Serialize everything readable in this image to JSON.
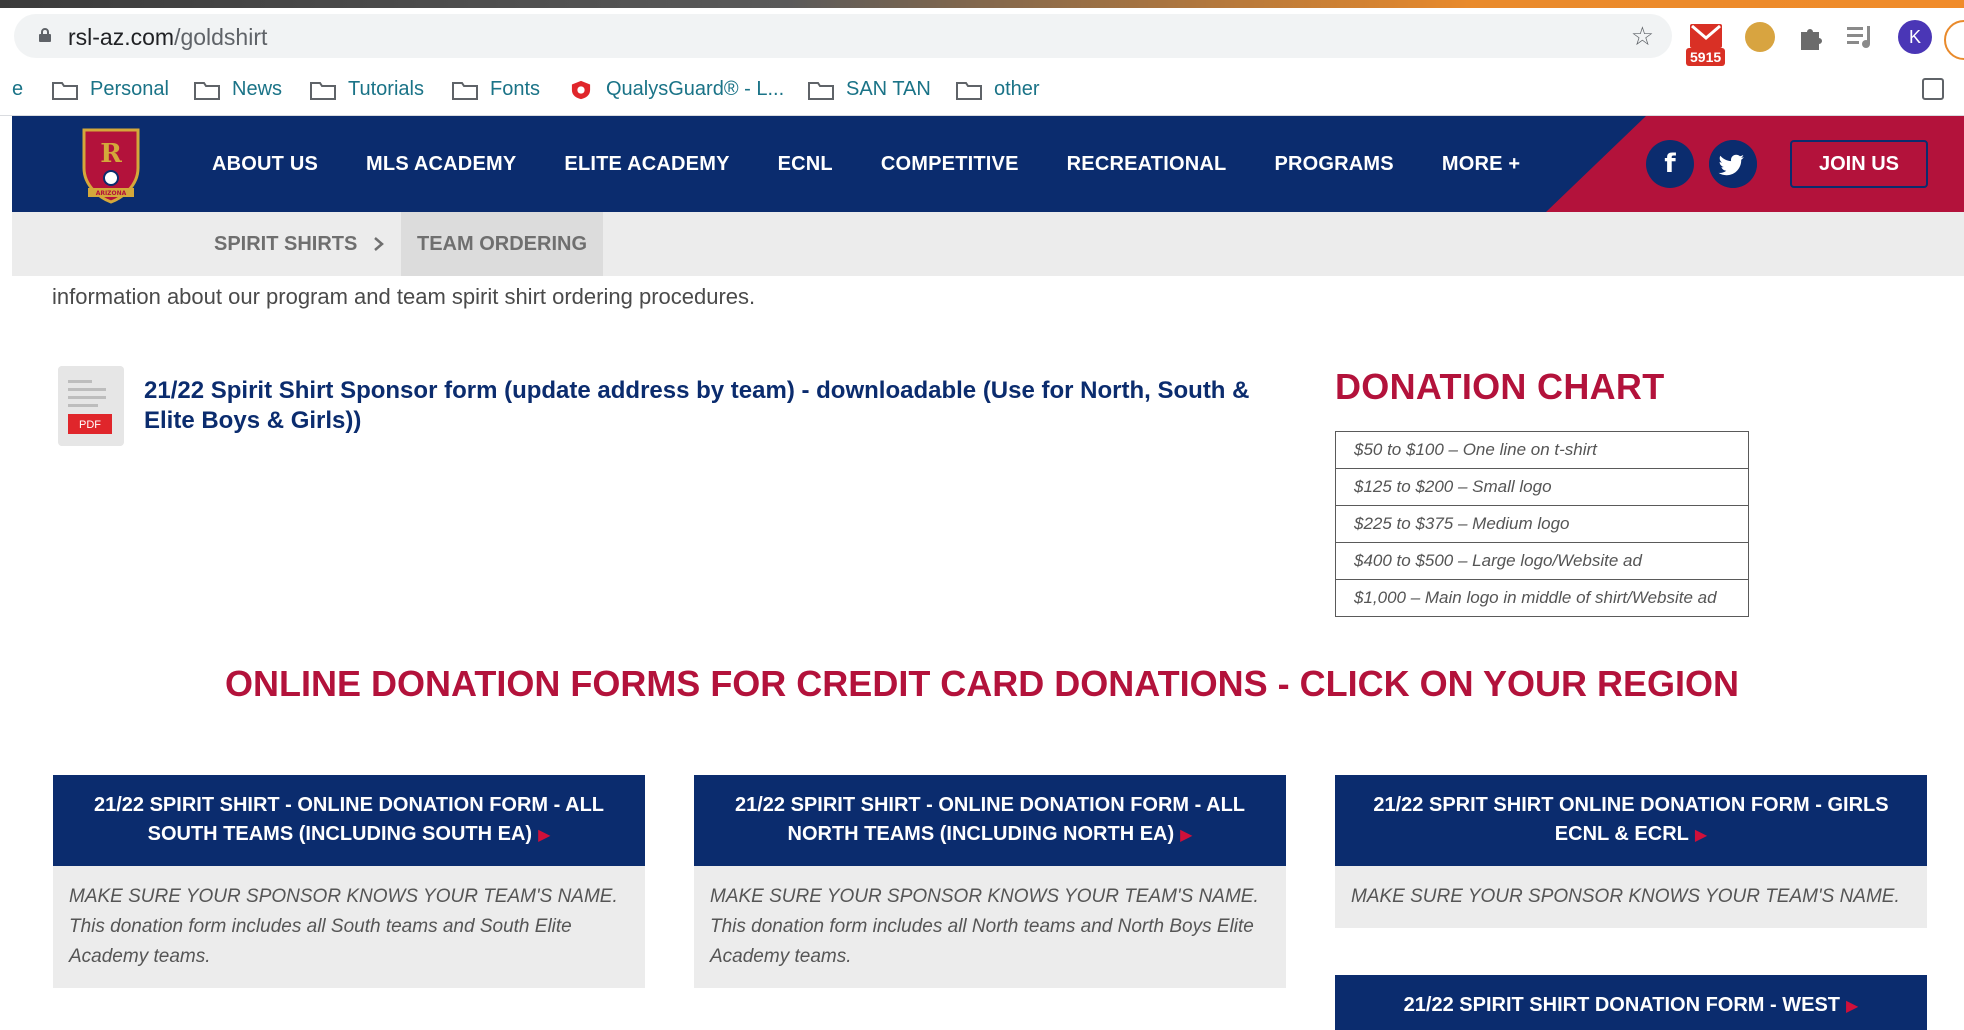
{
  "browser": {
    "url_host": "rsl-az.com",
    "url_path": "/goldshirt",
    "gmail_badge": "5915",
    "avatar_letter": "K",
    "bookmarks": [
      {
        "label": "e"
      },
      {
        "label": "Personal"
      },
      {
        "label": "News"
      },
      {
        "label": "Tutorials"
      },
      {
        "label": "Fonts"
      },
      {
        "label": "QualysGuard® - L..."
      },
      {
        "label": "SAN TAN"
      },
      {
        "label": "other"
      }
    ]
  },
  "site": {
    "nav": [
      "ABOUT US",
      "MLS ACADEMY",
      "ELITE ACADEMY",
      "ECNL",
      "COMPETITIVE",
      "RECREATIONAL",
      "PROGRAMS",
      "MORE +"
    ],
    "social": {
      "facebook": "f"
    },
    "join_label": "JOIN US",
    "breadcrumb": [
      "SPIRIT SHIRTS",
      "TEAM ORDERING"
    ],
    "crest_text": "ARIZONA",
    "colors": {
      "navy": "#0b2c6e",
      "red": "#b3123b"
    }
  },
  "content": {
    "intro": "information about our program and team spirit shirt ordering procedures.",
    "pdf_label": "PDF",
    "pdf_link": "21/22 Spirit Shirt Sponsor form (update address by team) - downloadable (Use for North, South & Elite Boys & Girls))",
    "donation_title": "DONATION CHART",
    "donation_rows": [
      "$50 to $100 – One line on t-shirt",
      "$125 to $200 – Small logo",
      "$225 to $375 – Medium logo",
      "$400 to $500 – Large logo/Website ad",
      "$1,000 – Main logo in middle of shirt/Website ad"
    ],
    "region_title": "ONLINE DONATION FORMS FOR CREDIT CARD DONATIONS - CLICK ON YOUR REGION",
    "cards": [
      {
        "title": "21/22 SPIRIT SHIRT - ONLINE DONATION FORM - ALL SOUTH TEAMS (INCLUDING SOUTH EA)",
        "body": "MAKE SURE YOUR SPONSOR KNOWS YOUR TEAM'S NAME. This donation form includes all South teams and South Elite Academy teams."
      },
      {
        "title": "21/22 SPIRIT SHIRT - ONLINE DONATION FORM - ALL NORTH TEAMS (INCLUDING NORTH EA)",
        "body": "MAKE SURE YOUR SPONSOR KNOWS YOUR TEAM'S NAME. This donation form includes all North teams and North Boys Elite Academy teams."
      },
      {
        "title": "21/22 SPRIT SHIRT ONLINE DONATION FORM - GIRLS ECNL & ECRL",
        "body": "MAKE SURE YOUR SPONSOR KNOWS YOUR TEAM'S NAME."
      },
      {
        "title": "21/22 SPIRIT SHIRT DONATION FORM - WEST",
        "body": ""
      }
    ]
  }
}
